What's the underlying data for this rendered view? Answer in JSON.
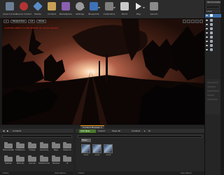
{
  "toolbar": {
    "buttons": [
      {
        "label": "Save Current",
        "icon": "save-icon",
        "color": "#6b7f94"
      },
      {
        "label": "Source Control",
        "icon": "source-control-icon",
        "color": "#b33434"
      },
      {
        "label": "Modes",
        "icon": "modes-icon",
        "color": "#5a8cc9"
      },
      {
        "label": "Content",
        "icon": "content-icon",
        "color": "#c7a055"
      },
      {
        "label": "Marketplace",
        "icon": "marketplace-icon",
        "color": "#8a5fb0"
      },
      {
        "label": "Settings",
        "icon": "settings-icon",
        "color": "#9a9a9a"
      },
      {
        "label": "Blueprints",
        "icon": "blueprints-icon",
        "color": "#3d72b8"
      },
      {
        "label": "Cinematics",
        "icon": "cinematics-icon",
        "color": "#7e7e7e"
      },
      {
        "label": "Build",
        "icon": "build-icon",
        "color": "#c9c9c9"
      },
      {
        "label": "Play",
        "icon": "play-icon",
        "color": "#e8e8e8"
      },
      {
        "label": "Launch",
        "icon": "launch-icon",
        "color": "#8a8a8a"
      }
    ]
  },
  "viewport": {
    "perspective_label": "Perspective",
    "lit_label": "Lit",
    "show_label": "Show",
    "warning_text": "LIGHTING NEEDS TO BE REBUILT (8 unbuilt objects)"
  },
  "world_outliner": {
    "tab_label": "World Outliner",
    "column_label": "Label",
    "rows": 9
  },
  "content_browser": {
    "tab_label": "Content Browser 1",
    "left_title": "Content",
    "add_new_label": "Add New",
    "import_label": "Import",
    "save_all_label": "Save All",
    "path_root": "Content",
    "path_child": "UI",
    "filters_label": "Filters",
    "folders": [
      "ElementalSky",
      "FirstPerson",
      "Foliage",
      "Geometry",
      "Maps",
      "Materials",
      "Meshes",
      "Particles",
      "Sounds",
      "StarterContent",
      "Textures",
      "UI"
    ],
    "assets": [
      "Icon1",
      "Icon2",
      "Icon3"
    ],
    "items_count": "3 items",
    "view_options_label": "View Options"
  }
}
